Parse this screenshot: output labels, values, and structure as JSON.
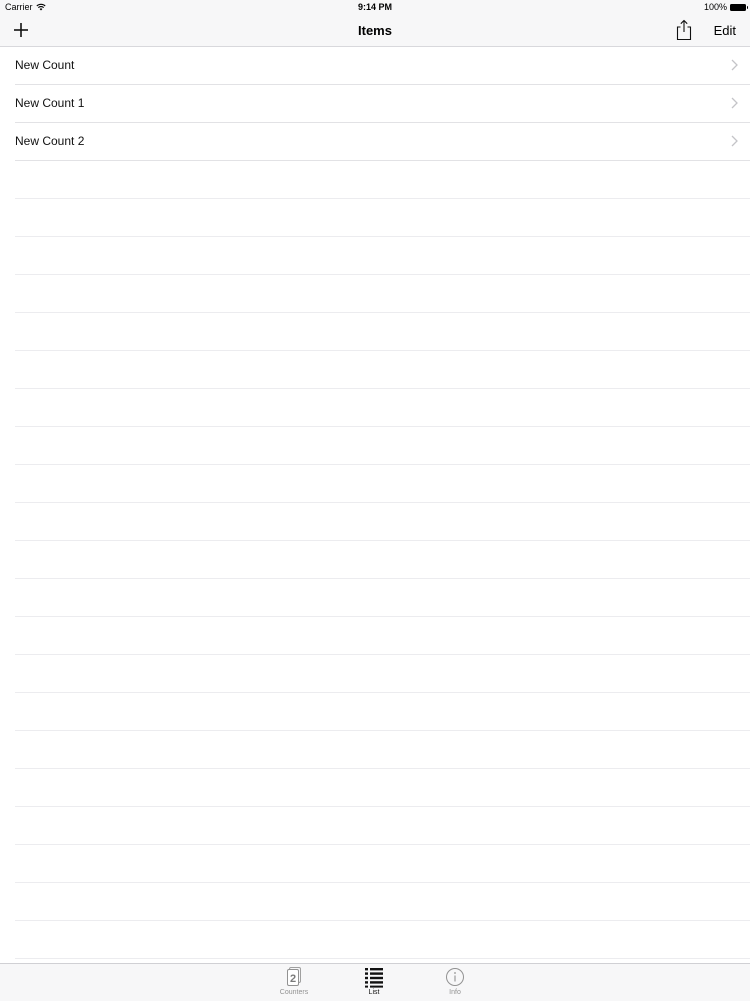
{
  "status_bar": {
    "carrier": "Carrier",
    "time": "9:14 PM",
    "battery": "100%"
  },
  "nav": {
    "title": "Items",
    "edit_label": "Edit",
    "add_icon": "plus-icon",
    "share_icon": "share-icon"
  },
  "list": {
    "items": [
      {
        "label": "New Count"
      },
      {
        "label": "New Count 1"
      },
      {
        "label": "New Count 2"
      }
    ]
  },
  "tabs": [
    {
      "label": "Counters",
      "icon": "counters-icon",
      "badge": "2",
      "active": false
    },
    {
      "label": "List",
      "icon": "list-icon",
      "active": true
    },
    {
      "label": "Info",
      "icon": "info-icon",
      "active": false
    }
  ],
  "colors": {
    "bar_background": "#f7f7f8",
    "separator": "#e2e2e5",
    "inactive_tab": "#929292"
  }
}
